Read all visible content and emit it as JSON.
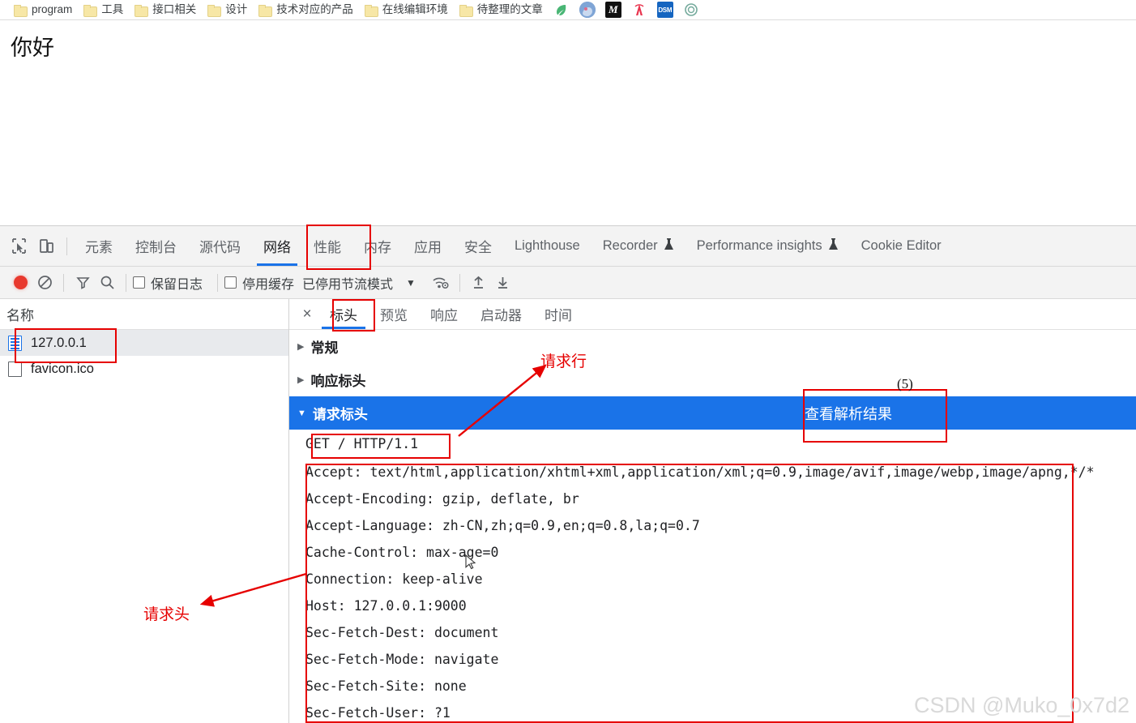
{
  "browser": {
    "bookmarks": [
      {
        "label": "program",
        "icon": "folder-icon"
      },
      {
        "label": "工具",
        "icon": "folder-icon"
      },
      {
        "label": "接口相关",
        "icon": "folder-icon"
      },
      {
        "label": "设计",
        "icon": "folder-icon"
      },
      {
        "label": "技术对应的产品",
        "icon": "folder-icon"
      },
      {
        "label": "在线编辑环境",
        "icon": "folder-icon"
      },
      {
        "label": "待整理的文章",
        "icon": "folder-icon"
      }
    ],
    "shortcut_icons": [
      {
        "name": "leaf-icon",
        "glyph": "🍃"
      },
      {
        "name": "anime-avatar-icon",
        "glyph": ""
      },
      {
        "name": "medium-m-icon",
        "glyph": "M"
      },
      {
        "name": "tower-icon",
        "glyph": "Θ"
      },
      {
        "name": "dsm-icon",
        "glyph": "DSM"
      },
      {
        "name": "openai-icon",
        "glyph": "✺"
      }
    ]
  },
  "page": {
    "body_text": "你好"
  },
  "devtools": {
    "tabs": [
      {
        "label": "元素",
        "cjk": true,
        "active": false,
        "flask": false
      },
      {
        "label": "控制台",
        "cjk": true,
        "active": false,
        "flask": false
      },
      {
        "label": "源代码",
        "cjk": true,
        "active": false,
        "flask": false
      },
      {
        "label": "网络",
        "cjk": true,
        "active": true,
        "flask": false
      },
      {
        "label": "性能",
        "cjk": true,
        "active": false,
        "flask": false
      },
      {
        "label": "内存",
        "cjk": true,
        "active": false,
        "flask": false
      },
      {
        "label": "应用",
        "cjk": true,
        "active": false,
        "flask": false
      },
      {
        "label": "安全",
        "cjk": true,
        "active": false,
        "flask": false
      },
      {
        "label": "Lighthouse",
        "cjk": false,
        "active": false,
        "flask": false
      },
      {
        "label": "Recorder",
        "cjk": false,
        "active": false,
        "flask": true
      },
      {
        "label": "Performance insights",
        "cjk": false,
        "active": false,
        "flask": true
      },
      {
        "label": "Cookie Editor",
        "cjk": false,
        "active": false,
        "flask": false
      }
    ],
    "network_toolbar": {
      "record_label": "record-button",
      "clear_label": "clear-button",
      "filter_label": "filter-button",
      "search_label": "search-button",
      "preserve_log": "保留日志",
      "disable_cache": "停用缓存",
      "throttling": "已停用节流模式",
      "dropdown_caret": "▼",
      "wifi_label": "network-conditions",
      "upload_label": "import-har",
      "download_label": "export-har"
    },
    "requests_panel": {
      "column_header": "名称",
      "rows": [
        {
          "name": "127.0.0.1",
          "icon": "document-icon",
          "selected": true
        },
        {
          "name": "favicon.ico",
          "icon": "blank-file-icon",
          "selected": false
        }
      ]
    },
    "detail_panel": {
      "close_label": "×",
      "subtabs": [
        {
          "label": "标头",
          "active": true
        },
        {
          "label": "预览",
          "active": false
        },
        {
          "label": "响应",
          "active": false
        },
        {
          "label": "启动器",
          "active": false
        },
        {
          "label": "时间",
          "active": false
        }
      ],
      "sections": [
        {
          "label": "常规",
          "expanded": false,
          "caret": "▶"
        },
        {
          "label": "响应标头",
          "expanded": false,
          "caret": "▶"
        },
        {
          "label": "请求标头",
          "expanded": true,
          "caret": "▼"
        }
      ],
      "view_parsed_button": "查看解析结果",
      "request_line": "GET / HTTP/1.1",
      "headers": [
        "Accept: text/html,application/xhtml+xml,application/xml;q=0.9,image/avif,image/webp,image/apng,*/*",
        "Accept-Encoding: gzip, deflate, br",
        "Accept-Language: zh-CN,zh;q=0.9,en;q=0.8,la;q=0.7",
        "Cache-Control: max-age=0",
        "Connection: keep-alive",
        "Host: 127.0.0.1:9000",
        "Sec-Fetch-Dest: document",
        "Sec-Fetch-Mode: navigate",
        "Sec-Fetch-Site: none",
        "Sec-Fetch-User: ?1"
      ]
    }
  },
  "annotations": {
    "request_line_label": "请求行",
    "request_headers_label": "请求头",
    "step_number": "(5)",
    "accent_color": "#e60000"
  },
  "watermark": "CSDN @Muko_0x7d2"
}
